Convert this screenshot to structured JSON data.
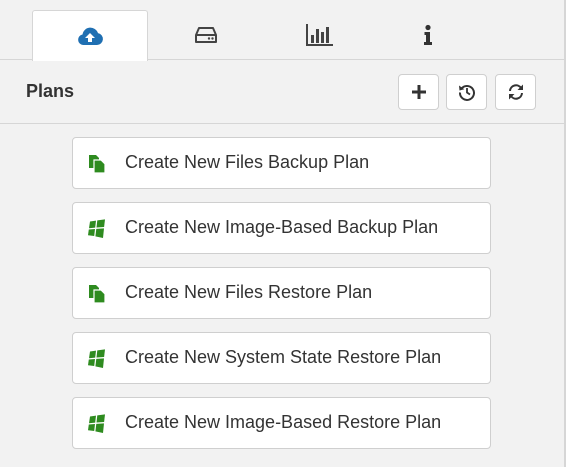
{
  "tabs": [
    {
      "icon": "cloud-upload-icon",
      "active": true
    },
    {
      "icon": "hard-drive-icon",
      "active": false
    },
    {
      "icon": "bar-chart-icon",
      "active": false
    },
    {
      "icon": "info-icon",
      "active": false
    }
  ],
  "header": {
    "title": "Plans",
    "buttons": [
      {
        "icon": "plus-icon"
      },
      {
        "icon": "history-icon"
      },
      {
        "icon": "refresh-icon"
      }
    ]
  },
  "plans": [
    {
      "label": "Create New Files Backup Plan",
      "icon": "files-icon"
    },
    {
      "label": "Create New Image-Based Backup Plan",
      "icon": "windows-icon"
    },
    {
      "label": "Create New Files Restore Plan",
      "icon": "files-icon"
    },
    {
      "label": "Create New System State Restore Plan",
      "icon": "windows-icon"
    },
    {
      "label": "Create New Image-Based Restore Plan",
      "icon": "windows-icon"
    }
  ],
  "colors": {
    "accent": "#1f6fb2",
    "plan_icon": "#2e8b1f",
    "border": "#cfcfcf",
    "background": "#f2f2f2"
  }
}
